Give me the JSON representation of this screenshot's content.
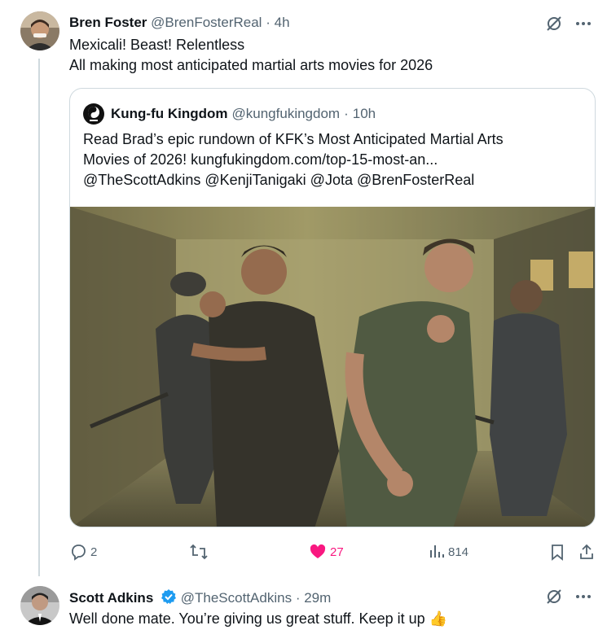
{
  "tweet1": {
    "name": "Bren Foster",
    "handle": "@BrenFosterReal",
    "time": "4h",
    "line1": "Mexicali! Beast! Relentless",
    "line2": "All making most anticipated martial arts movies for 2026"
  },
  "quote": {
    "name": "Kung-fu Kingdom",
    "handle": "@kungfukingdom",
    "time": "10h",
    "line1": "Read Brad’s epic rundown of KFK’s Most Anticipated Martial Arts",
    "line2": "Movies of 2026! kungfukingdom.com/top-15-most-an...",
    "line3": "@TheScottAdkins @KenjiTanigaki @Jota @BrenFosterReal"
  },
  "actions": {
    "replies": "2",
    "likes": "27",
    "views": "814"
  },
  "tweet2": {
    "name": "Scott Adkins",
    "handle": "@TheScottAdkins",
    "time": "29m",
    "text": "Well done mate. You’re giving us great stuff. Keep it up",
    "emoji": "👍"
  },
  "colors": {
    "like": "#f91880",
    "muted": "#536471",
    "verified": "#1d9bf0",
    "border": "#cfd9de"
  },
  "icons": [
    "grok-icon",
    "more-icon",
    "reply-icon",
    "retweet-icon",
    "heart-icon",
    "views-icon",
    "bookmark-icon",
    "share-icon",
    "verified-icon",
    "kfk-logo"
  ]
}
